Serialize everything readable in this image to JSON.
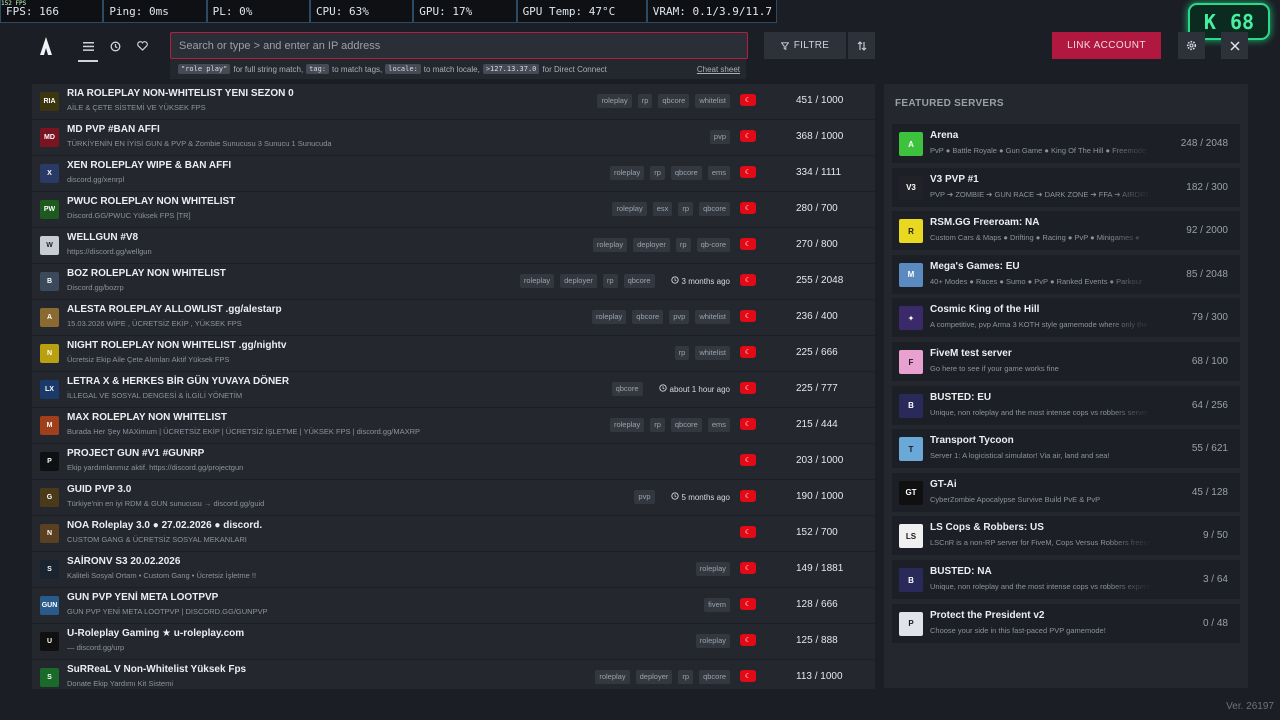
{
  "perf": {
    "tiny_fps": "152 FPS",
    "items": [
      "FPS: 166",
      "Ping: 0ms",
      "PL: 0%",
      "CPU: 63%",
      "GPU: 17%",
      "GPU Temp: 47°C",
      "VRAM: 0.1/3.9/11.7 GB"
    ]
  },
  "badge": {
    "letter": "K",
    "value": "68"
  },
  "search": {
    "placeholder": "Search or type > and enter an IP address",
    "hint": {
      "code1": "\"role play\"",
      "text1": "for full string match,",
      "code2": "tag:",
      "text2": "to match tags,",
      "code3": "locale:",
      "text3": "to match locale,",
      "code4": ">127.13.37.0",
      "text4": "for Direct Connect",
      "cheat": "Cheat sheet"
    }
  },
  "toolbar": {
    "filter_label": "FILTRE",
    "link_label": "LINK ACCOUNT"
  },
  "colors": {
    "accent": "#b01840",
    "flag": "#e30a17",
    "panel": "#24272e",
    "bg": "#1b1e24"
  },
  "servers": [
    {
      "name": "RIA ROLEPLAY NON-WHITELIST YENI SEZON 0",
      "desc": "AİLE & ÇETE SİSTEMİ VE YÜKSEK FPS",
      "tags": [
        "roleplay",
        "rp",
        "qbcore",
        "whitelist"
      ],
      "time": "",
      "players": "451 / 1000",
      "icon": "RIA",
      "icon_color": "#3b3510"
    },
    {
      "name": "MD PVP #BAN AFFI",
      "desc": "TÜRKİYENİN EN İYİSİ GUN & PVP & Zombie Sunucusu 3 Sunucu 1 Sunucuda",
      "tags": [
        "pvp"
      ],
      "time": "",
      "players": "368 / 1000",
      "icon": "MD",
      "icon_color": "#7a1420"
    },
    {
      "name": "XEN ROLEPLAY WIPE & BAN AFFI",
      "desc": "discord.gg/xenrpl",
      "tags": [
        "roleplay",
        "rp",
        "qbcore",
        "ems"
      ],
      "time": "",
      "players": "334 / 1111",
      "icon": "X",
      "icon_color": "#2a3a66"
    },
    {
      "name": "PWUC ROLEPLAY NON WHITELIST",
      "desc": "Discord.GG/PWUC Yüksek FPS [TR]",
      "tags": [
        "roleplay",
        "esx",
        "rp",
        "qbcore"
      ],
      "time": "",
      "players": "280 / 700",
      "icon": "PW",
      "icon_color": "#1d5a1d"
    },
    {
      "name": "WELLGUN #V8",
      "desc": "https://discord.gg/wellgun",
      "tags": [
        "roleplay",
        "deployer",
        "rp",
        "qb-core"
      ],
      "time": "",
      "players": "270 / 800",
      "icon": "W",
      "icon_color": "#c8ccd4"
    },
    {
      "name": "BOZ ROLEPLAY NON WHITELIST",
      "desc": "Discord.gg/bozrp",
      "tags": [
        "roleplay",
        "deployer",
        "rp",
        "qbcore"
      ],
      "time": "3 months ago",
      "players": "255 / 2048",
      "icon": "B",
      "icon_color": "#3a4a5a"
    },
    {
      "name": "ALESTA ROLEPLAY ALLOWLIST .gg/alestarp",
      "desc": "15.03.2026 WİPE , ÜCRETSİZ EKİP , YÜKSEK FPS",
      "tags": [
        "roleplay",
        "qbcore",
        "pvp",
        "whitelist"
      ],
      "time": "",
      "players": "236 / 400",
      "icon": "A",
      "icon_color": "#8a6a30"
    },
    {
      "name": "NIGHT ROLEPLAY NON WHITELIST .gg/nightv",
      "desc": "Ücretsiz Ekip Aile Çete Alımları Aktif Yüksek FPS",
      "tags": [
        "rp",
        "whitelist"
      ],
      "time": "",
      "players": "225 / 666",
      "icon": "N",
      "icon_color": "#b8a010"
    },
    {
      "name": "LETRA X & HERKES BİR GÜN YUVAYA DÖNER",
      "desc": "İLLEGAL VE SOSYAL DENGESİ & İLGİLİ YÖNETİM",
      "tags": [
        "qbcore"
      ],
      "time": "about 1 hour ago",
      "players": "225 / 777",
      "icon": "LX",
      "icon_color": "#1a3a6a"
    },
    {
      "name": "MAX ROLEPLAY NON WHITELIST",
      "desc": "Burada Her Şey MAXimum | ÜCRETSİZ EKİP | ÜCRETSİZ İŞLETME | YÜKSEK FPS | discord.gg/MAXRP",
      "tags": [
        "roleplay",
        "rp",
        "qbcore",
        "ems"
      ],
      "time": "",
      "players": "215 / 444",
      "icon": "M",
      "icon_color": "#a0401a"
    },
    {
      "name": "PROJECT GUN #V1 #GUNRP",
      "desc": "Ekip yardımlarımız aktif. https://discord.gg/projectgun",
      "tags": [],
      "time": "",
      "players": "203 / 1000",
      "icon": "P",
      "icon_color": "#0e1014"
    },
    {
      "name": "GUID PVP 3.0",
      "desc": "Türkiye'nin en iyi RDM & GUN sunucusu → discord.gg/guid",
      "tags": [
        "pvp"
      ],
      "time": "5 months ago",
      "players": "190 / 1000",
      "icon": "G",
      "icon_color": "#4a3a1a"
    },
    {
      "name": "NOA Roleplay 3.0 ● 27.02.2026 ● discord.",
      "desc": "CUSTOM GANG & ÜCRETSİZ SOSYAL MEKANLARI",
      "tags": [],
      "time": "",
      "players": "152 / 700",
      "icon": "N",
      "icon_color": "#5a4020"
    },
    {
      "name": "SAİRONV S3 20.02.2026",
      "desc": "Kaliteli Sosyal Ortam • Custom Gang • Ücretsiz İşletme !!",
      "tags": [
        "roleplay"
      ],
      "time": "",
      "players": "149 / 1881",
      "icon": "S",
      "icon_color": "#1a2430"
    },
    {
      "name": "GUN PVP YENİ META LOOTPVP",
      "desc": "GUN PVP YENİ META LOOTPVP | DISCORD.GG/GUNPVP",
      "tags": [
        "fivem"
      ],
      "time": "",
      "players": "128 / 666",
      "icon": "GUN",
      "icon_color": "#2a5a8a"
    },
    {
      "name": "U-Roleplay Gaming ★ u-roleplay.com",
      "desc": "— discord.gg/urp",
      "tags": [
        "roleplay"
      ],
      "time": "",
      "players": "125 / 888",
      "icon": "U",
      "icon_color": "#101010"
    },
    {
      "name": "SuRReaL V Non-Whitelist Yüksek Fps",
      "desc": "Donate Ekip Yardımı Kit Sistemi",
      "tags": [
        "roleplay",
        "deployer",
        "rp",
        "qbcore"
      ],
      "time": "",
      "players": "113 / 1000",
      "icon": "S",
      "icon_color": "#1a6a2a"
    }
  ],
  "featured": {
    "title": "FEATURED SERVERS",
    "items": [
      {
        "name": "Arena",
        "desc": "PvP ● Battle Royale ● Gun Game ● King Of The Hill ● Freemode",
        "players": "248 / 2048",
        "icon": "A",
        "icon_color": "#3cc23c"
      },
      {
        "name": "V3 PVP #1",
        "desc": "PVP ➔ ZOMBIE ➔ GUN RACE ➔ DARK ZONE ➔ FFA ➔ AIRDROP",
        "players": "182 / 300",
        "icon": "V3",
        "icon_color": "#202228"
      },
      {
        "name": "RSM.GG Freeroam: NA",
        "desc": "Custom Cars & Maps ● Drifting ● Racing ● PvP ● Minigames ●",
        "players": "92 / 2000",
        "icon": "R",
        "icon_color": "#e8d820"
      },
      {
        "name": "Mega's Games: EU",
        "desc": "40+ Modes ● Races ● Sumo ● PvP ● Ranked Events ● Parkour",
        "players": "85 / 2048",
        "icon": "M",
        "icon_color": "#5a8ac0"
      },
      {
        "name": "Cosmic King of the Hill",
        "desc": "A competitive, pvp Arma 3 KOTH style gamemode where only the best",
        "players": "79 / 300",
        "icon": "✦",
        "icon_color": "#3a2a6a"
      },
      {
        "name": "FiveM test server",
        "desc": "Go here to see if your game works fine",
        "players": "68 / 100",
        "icon": "F",
        "icon_color": "#e8a0d0"
      },
      {
        "name": "BUSTED: EU",
        "desc": "Unique, non roleplay and the most intense cops vs robbers server",
        "players": "64 / 256",
        "icon": "B",
        "icon_color": "#2a2a5a"
      },
      {
        "name": "Transport Tycoon",
        "desc": "Server 1: A logicistical simulator! Via air, land and sea!",
        "players": "55 / 621",
        "icon": "T",
        "icon_color": "#6aa8d8"
      },
      {
        "name": "GT-Ai",
        "desc": "CyberZombie Apocalypse Survive Build PvE & PvP",
        "players": "45 / 128",
        "icon": "GT",
        "icon_color": "#101010"
      },
      {
        "name": "LS Cops & Robbers: US",
        "desc": "LSCnR is a non-RP server for FiveM, Cops Versus Robbers freeroam",
        "players": "9 / 50",
        "icon": "LS",
        "icon_color": "#f0f0f0"
      },
      {
        "name": "BUSTED: NA",
        "desc": "Unique, non roleplay and the most intense cops vs robbers experience",
        "players": "3 / 64",
        "icon": "B",
        "icon_color": "#2a2a5a"
      },
      {
        "name": "Protect the President v2",
        "desc": "Choose your side in this fast-paced PVP gamemode!",
        "players": "0 / 48",
        "icon": "P",
        "icon_color": "#e0e4ea"
      }
    ]
  },
  "version": "Ver. 26197"
}
